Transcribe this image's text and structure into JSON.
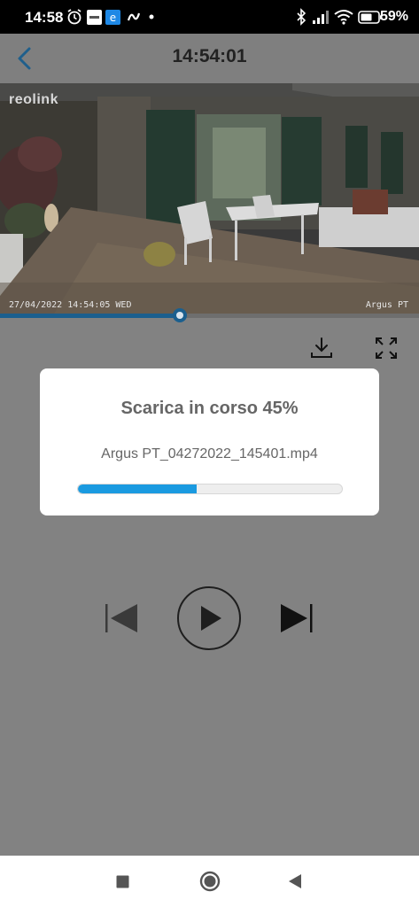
{
  "status_bar": {
    "time": "14:58",
    "battery_text": "59%"
  },
  "header": {
    "title": "14:54:01"
  },
  "video": {
    "logo_text": "reolink",
    "timestamp_overlay": "27/04/2022 14:54:05 WED",
    "camera_name_overlay": "Argus PT",
    "playback_progress_fraction": 0.43
  },
  "actions": {
    "download_icon": "download-icon",
    "fullscreen_icon": "fullscreen-icon"
  },
  "dialog": {
    "title": "Scarica in corso 45%",
    "filename": "Argus PT_04272022_145401.mp4",
    "progress_fraction": 0.45,
    "accent_color": "#1a9ae0"
  },
  "controls": {
    "previous_icon": "skip-previous-icon",
    "play_icon": "play-icon",
    "next_icon": "skip-next-icon"
  },
  "nav": {
    "recents_icon": "square-icon",
    "home_icon": "circle-icon",
    "back_icon": "triangle-back-icon"
  },
  "colors": {
    "dim_background": "#828282",
    "player_accent": "#1b5f8e",
    "header_back": "#1f5f8c"
  }
}
